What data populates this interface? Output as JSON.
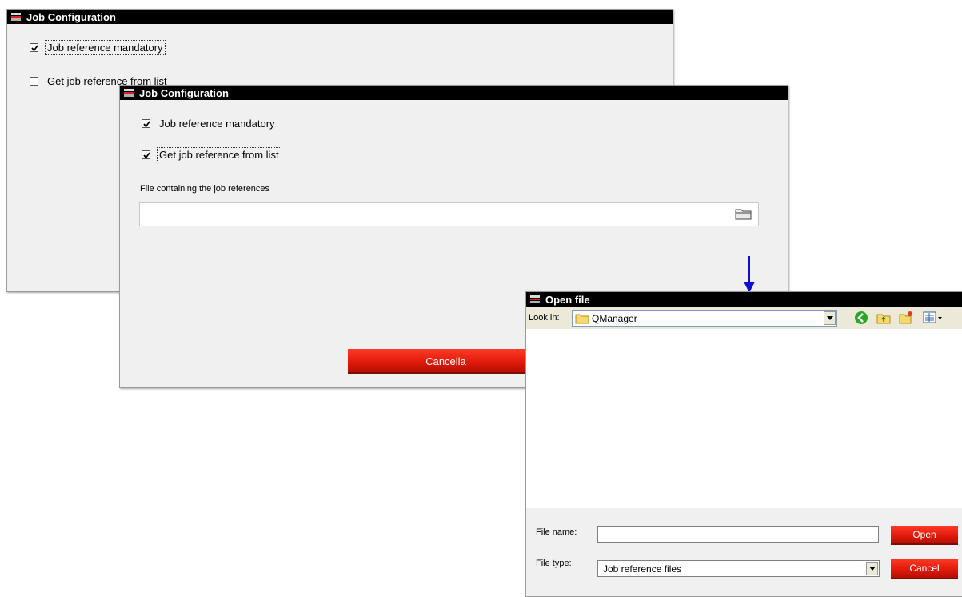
{
  "dialog1": {
    "title": "Job Configuration",
    "mandatory_label": "Job reference mandatory",
    "mandatory_checked": true,
    "list_label": "Get job reference from list",
    "list_checked": false
  },
  "dialog2": {
    "title": "Job Configuration",
    "mandatory_label": "Job reference mandatory",
    "mandatory_checked": true,
    "list_label": "Get job reference from list",
    "list_checked": true,
    "file_label": "File containing the job references",
    "file_value": "",
    "cancel_label": "Cancella"
  },
  "open_file": {
    "title": "Open file",
    "look_in_label": "Look in:",
    "look_in_value": "QManager",
    "file_name_label": "File name:",
    "file_name_value": "",
    "file_type_label": "File type:",
    "file_type_value": "Job reference files",
    "open_label": "Open",
    "cancel_label": "Cancel"
  },
  "icons": [
    "app-icon",
    "folder-icon",
    "back-icon",
    "up-folder-icon",
    "new-folder-icon",
    "view-menu-icon",
    "dropdown-arrow-icon",
    "down-arrow-icon"
  ],
  "colors": {
    "titlebar": "#000000",
    "window_bg": "#f0f0f0",
    "button_red": "#e21b0c",
    "arrow_blue": "#1010d0"
  }
}
